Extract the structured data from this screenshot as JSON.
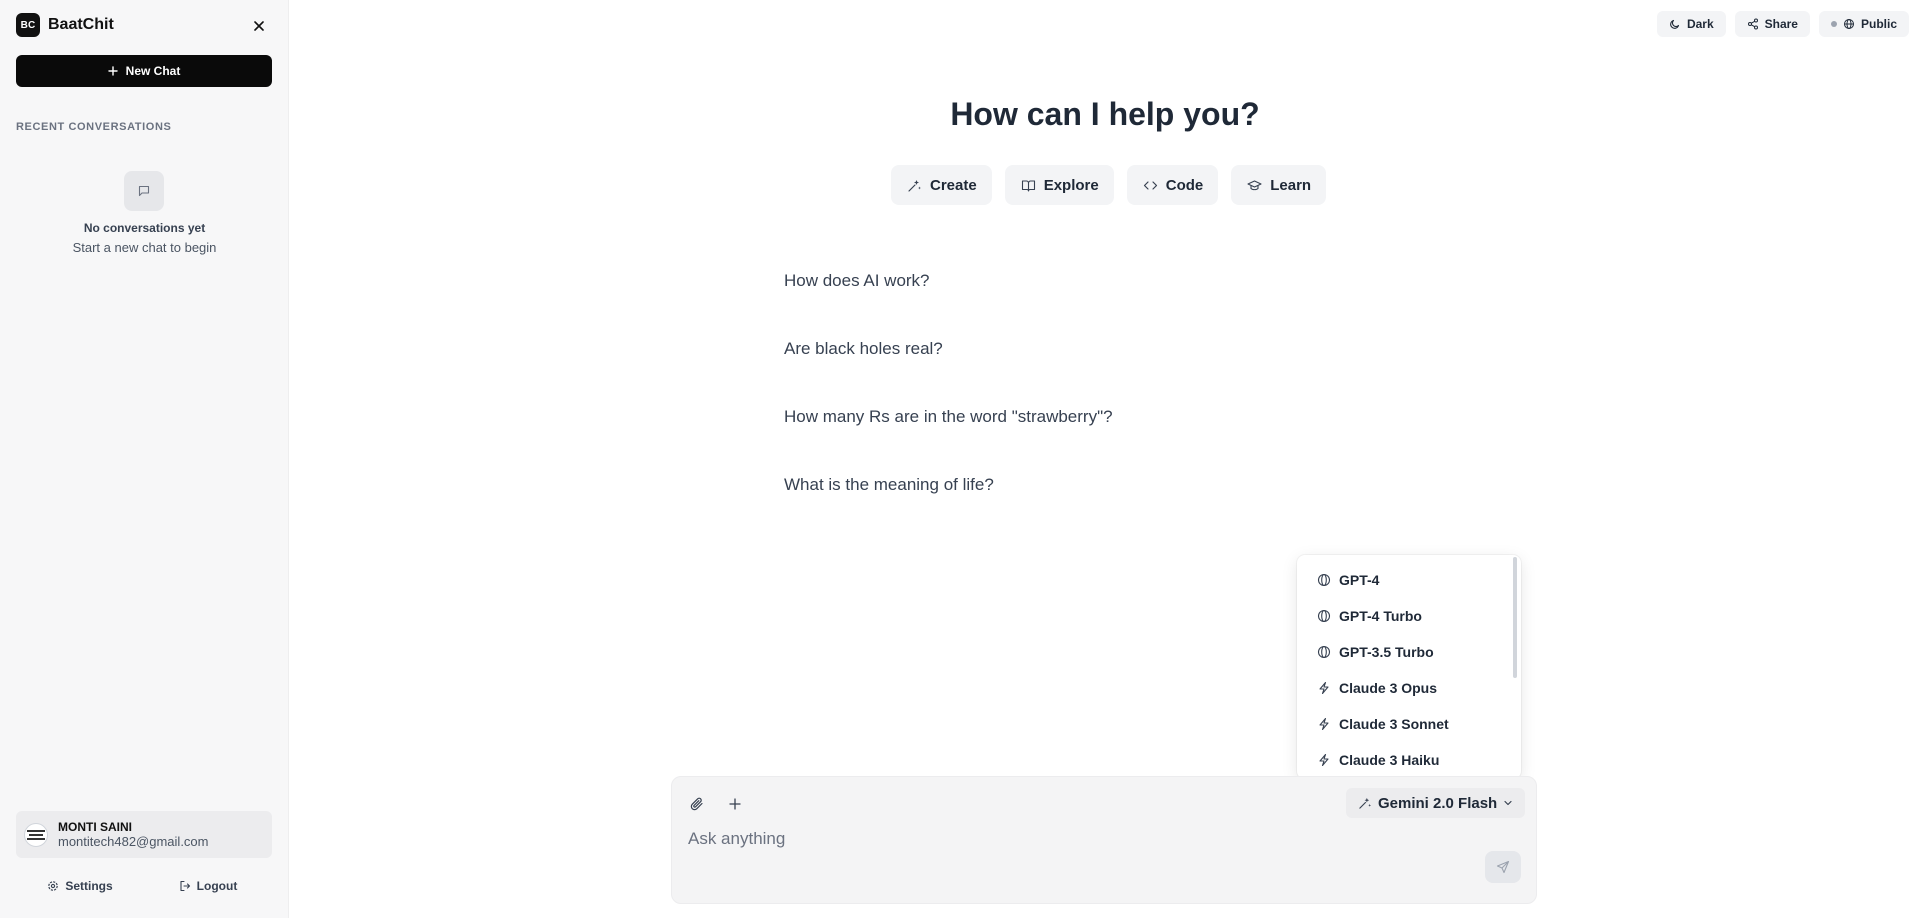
{
  "app": {
    "logo_text": "BC",
    "name": "BaatChit"
  },
  "sidebar": {
    "new_chat_label": "New Chat",
    "recent_label": "RECENT CONVERSATIONS",
    "empty_title": "No conversations yet",
    "empty_subtitle": "Start a new chat to begin",
    "user": {
      "name": "MONTI SAINI",
      "email": "montitech482@gmail.com"
    },
    "settings_label": "Settings",
    "logout_label": "Logout"
  },
  "topbar": {
    "dark_label": "Dark",
    "share_label": "Share",
    "public_label": "Public"
  },
  "main": {
    "headline": "How can I help you?",
    "actions": [
      {
        "label": "Create",
        "icon": "sparkles-icon"
      },
      {
        "label": "Explore",
        "icon": "book-icon"
      },
      {
        "label": "Code",
        "icon": "code-icon"
      },
      {
        "label": "Learn",
        "icon": "graduation-cap-icon"
      }
    ],
    "suggestions": [
      "How does AI work?",
      "Are black holes real?",
      "How many Rs are in the word \"strawberry\"?",
      "What is the meaning of life?"
    ]
  },
  "model_dropdown": {
    "items": [
      {
        "label": "GPT-4",
        "icon": "globe-icon"
      },
      {
        "label": "GPT-4 Turbo",
        "icon": "globe-icon"
      },
      {
        "label": "GPT-3.5 Turbo",
        "icon": "globe-icon"
      },
      {
        "label": "Claude 3 Opus",
        "icon": "bolt-icon"
      },
      {
        "label": "Claude 3 Sonnet",
        "icon": "bolt-icon"
      },
      {
        "label": "Claude 3 Haiku",
        "icon": "bolt-icon"
      }
    ]
  },
  "composer": {
    "selected_model": "Gemini 2.0 Flash",
    "placeholder": "Ask anything"
  }
}
